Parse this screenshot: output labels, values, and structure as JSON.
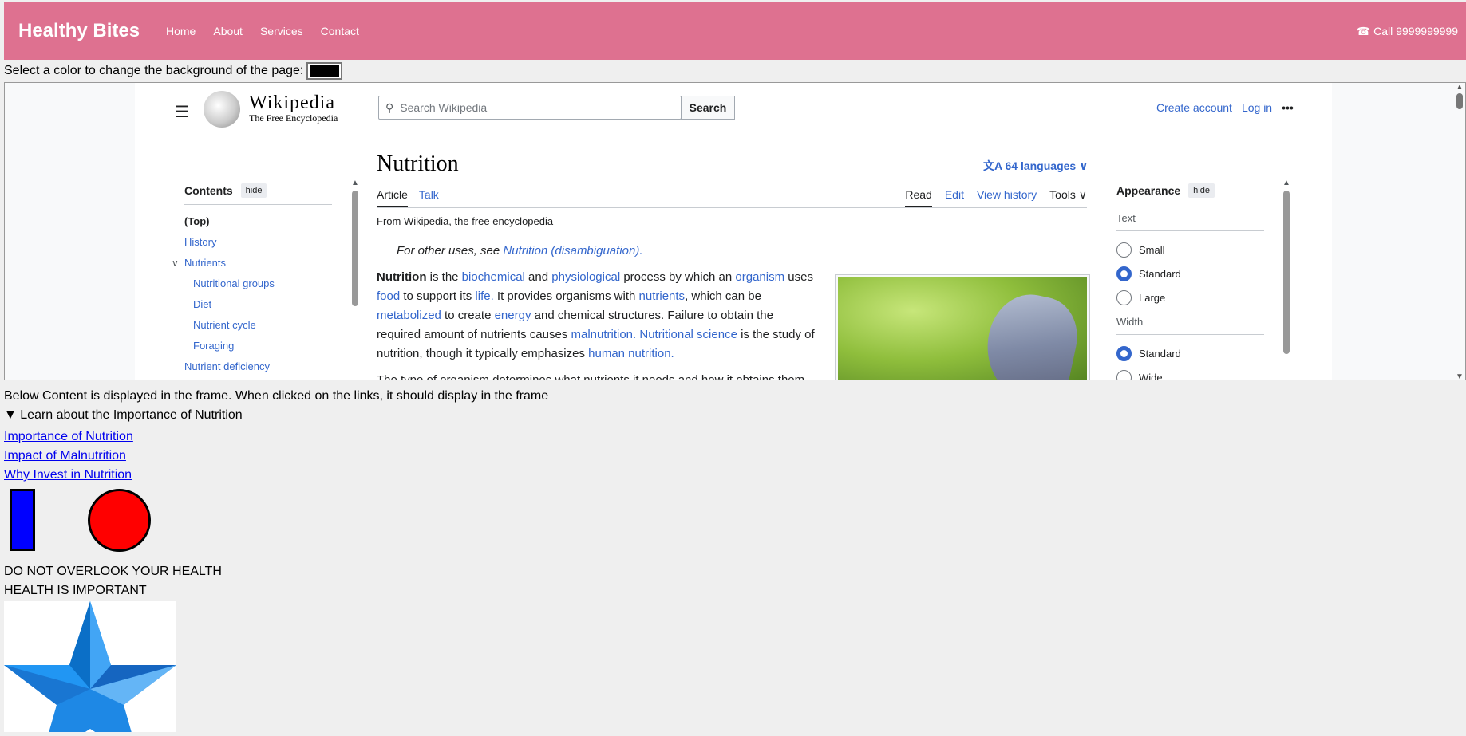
{
  "header": {
    "brand": "Healthy Bites",
    "nav": [
      "Home",
      "About",
      "Services",
      "Contact"
    ],
    "call": "☎ Call 9999999999",
    "bg_color": "#de7190"
  },
  "color_picker": {
    "label": "Select a color to change the background of the page:",
    "value": "#000000"
  },
  "wiki": {
    "logo_title": "Wikipedia",
    "logo_subtitle": "The Free Encyclopedia",
    "search_placeholder": "Search Wikipedia",
    "search_button": "Search",
    "create_account": "Create account",
    "log_in": "Log in",
    "more": "•••",
    "page_title": "Nutrition",
    "languages": "64 languages",
    "tabs_left": [
      "Article",
      "Talk"
    ],
    "tabs_right": [
      "Read",
      "Edit",
      "View history",
      "Tools"
    ],
    "from": "From Wikipedia, the free encyclopedia",
    "hatnote_prefix": "For other uses, see ",
    "hatnote_link": "Nutrition (disambiguation).",
    "para": {
      "w1": "Nutrition",
      "t1": " is the ",
      "l1": "biochemical",
      "t2": " and ",
      "l2": "physiological",
      "t3": " process by which an ",
      "l3": "organism",
      "t4": " uses ",
      "l4": "food",
      "t5": " to support its ",
      "l5": "life.",
      "t6": " It provides organisms with ",
      "l6": "nutrients",
      "t7": ", which can be ",
      "l7": "metabolized",
      "t8": " to create ",
      "l8": "energy",
      "t9": " and chemical structures. Failure to obtain the required amount of nutrients causes ",
      "l9": "malnutrition.",
      "t10": " ",
      "l10": "Nutritional science",
      "t11": " is the study of nutrition, though it typically emphasizes ",
      "l11": "human nutrition."
    },
    "para2": "The type of organism determines what nutrients it needs and how it obtains them.",
    "toc": {
      "title": "Contents",
      "hide": "hide",
      "items": [
        "(Top)",
        "History",
        "Nutrients",
        "Nutritional groups",
        "Diet",
        "Nutrient cycle",
        "Foraging",
        "Nutrient deficiency"
      ]
    },
    "appearance": {
      "title": "Appearance",
      "hide": "hide",
      "text_label": "Text",
      "text_options": [
        "Small",
        "Standard",
        "Large"
      ],
      "text_selected": "Standard",
      "width_label": "Width",
      "width_options": [
        "Standard",
        "Wide"
      ],
      "width_selected": "Standard"
    }
  },
  "below_text": "Below Content is displayed in the frame. When clicked on the links, it should display in the frame",
  "details_summary": "▼ Learn about the Importance of Nutrition",
  "links": [
    "Importance of Nutrition",
    "Impact of Malnutrition",
    "Why Invest in Nutrition"
  ],
  "shapes": {
    "rect_color": "#0000ff",
    "circle_color": "#ff0000"
  },
  "message1": "DO NOT OVERLOOK YOUR HEALTH",
  "message2": "HEALTH IS IMPORTANT"
}
